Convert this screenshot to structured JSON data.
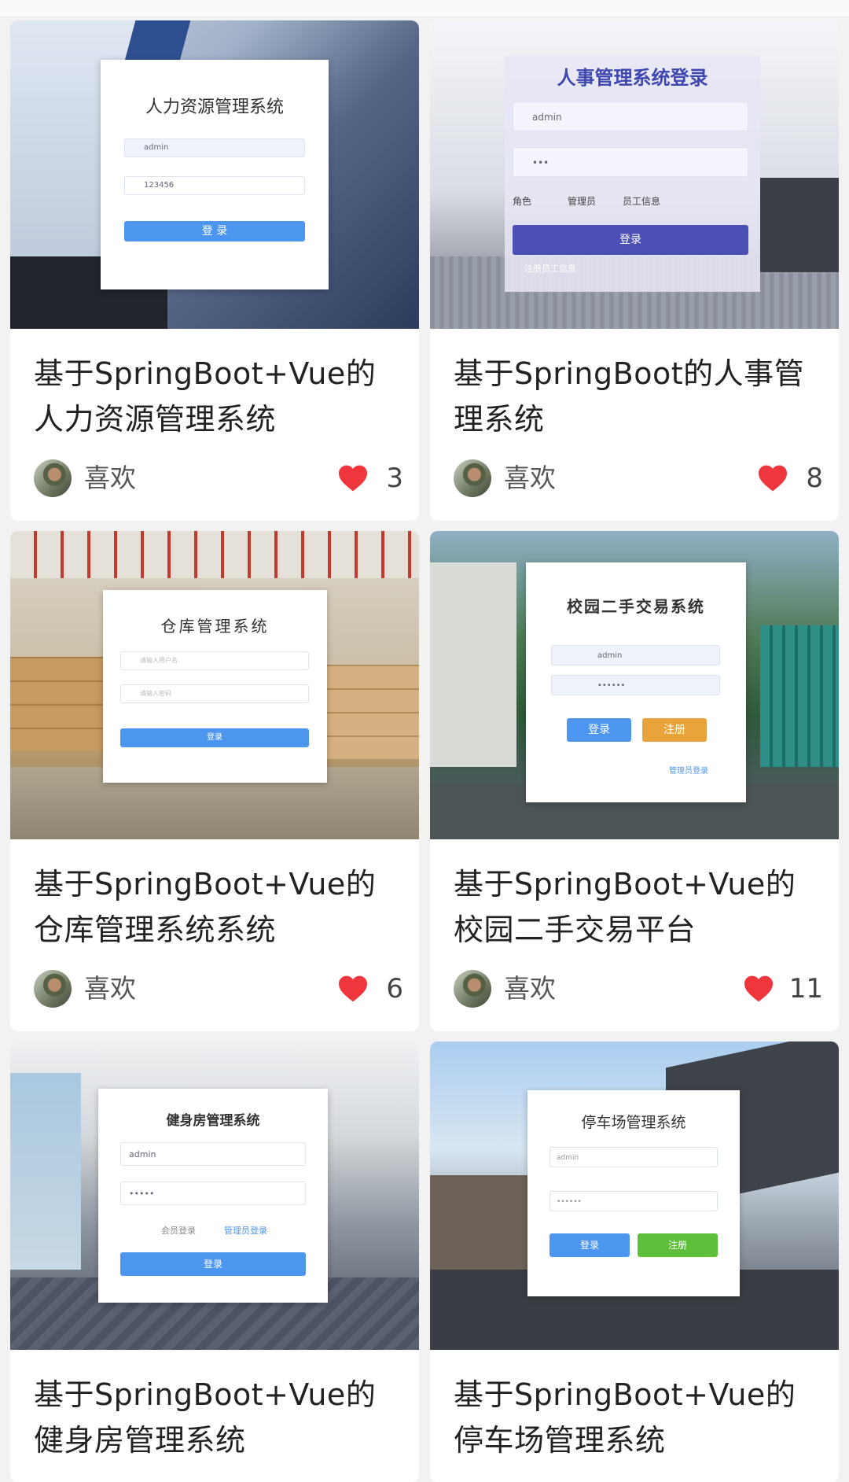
{
  "cards": [
    {
      "title_line1": "基于SpringBoot+Vue的",
      "title_line2": "人力资源管理系统",
      "like_label": "喜欢",
      "likes": "3",
      "screen": {
        "title": "人力资源管理系统",
        "user": "admin",
        "pass": "123456",
        "button": "登 录"
      }
    },
    {
      "title_line1": "基于SpringBoot的人事管",
      "title_line2": "理系统",
      "like_label": "喜欢",
      "likes": "8",
      "screen": {
        "title": "人事管理系统登录",
        "user": "admin",
        "pass": "•••",
        "role_label": "角色",
        "role_a": "管理员",
        "role_b": "员工信息",
        "button": "登录",
        "register": "注册员工信息"
      }
    },
    {
      "title_line1": "基于SpringBoot+Vue的",
      "title_line2": "仓库管理系统系统",
      "like_label": "喜欢",
      "likes": "6",
      "screen": {
        "title": "仓库管理系统",
        "user": "请输入用户名",
        "pass": "请输入密码",
        "button": "登录"
      }
    },
    {
      "title_line1": "基于SpringBoot+Vue的",
      "title_line2": "校园二手交易平台",
      "like_label": "喜欢",
      "likes": "11",
      "screen": {
        "title": "校园二手交易系统",
        "user": "admin",
        "pass": "••••••",
        "button": "登录",
        "register": "注册",
        "admin_link": "管理员登录"
      }
    },
    {
      "title_line1": "基于SpringBoot+Vue的",
      "title_line2": "健身房管理系统",
      "screen": {
        "title": "健身房管理系统",
        "user": "admin",
        "pass": "•••••",
        "role_a": "会员登录",
        "role_b": "管理员登录",
        "button": "登录"
      }
    },
    {
      "title_line1": "基于SpringBoot+Vue的",
      "title_line2": "停车场管理系统",
      "screen": {
        "title": "停车场管理系统",
        "user": "admin",
        "pass": "••••••",
        "button": "登录",
        "register": "注册"
      }
    }
  ],
  "colors": {
    "heart": "#f0363d",
    "primary_blue": "#4d96f0",
    "purple_btn": "#4b4fb3",
    "orange_btn": "#e8a33b",
    "green_btn": "#5ec03a"
  }
}
